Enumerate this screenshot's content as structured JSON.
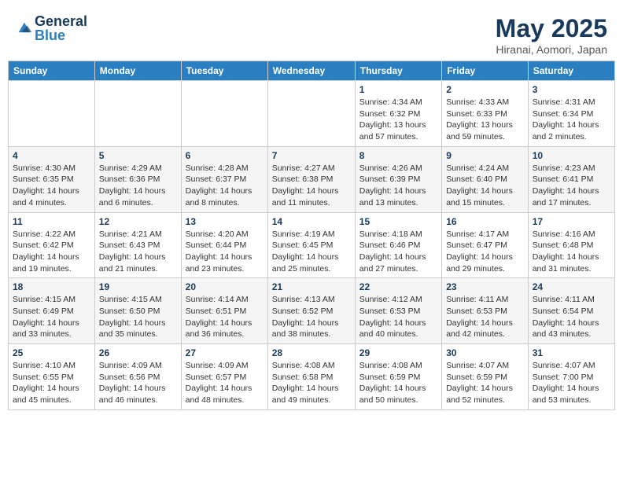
{
  "logo": {
    "general": "General",
    "blue": "Blue"
  },
  "title": {
    "month_year": "May 2025",
    "location": "Hiranai, Aomori, Japan"
  },
  "days_of_week": [
    "Sunday",
    "Monday",
    "Tuesday",
    "Wednesday",
    "Thursday",
    "Friday",
    "Saturday"
  ],
  "weeks": [
    [
      {
        "day": "",
        "info": ""
      },
      {
        "day": "",
        "info": ""
      },
      {
        "day": "",
        "info": ""
      },
      {
        "day": "",
        "info": ""
      },
      {
        "day": "1",
        "info": "Sunrise: 4:34 AM\nSunset: 6:32 PM\nDaylight: 13 hours and 57 minutes."
      },
      {
        "day": "2",
        "info": "Sunrise: 4:33 AM\nSunset: 6:33 PM\nDaylight: 13 hours and 59 minutes."
      },
      {
        "day": "3",
        "info": "Sunrise: 4:31 AM\nSunset: 6:34 PM\nDaylight: 14 hours and 2 minutes."
      }
    ],
    [
      {
        "day": "4",
        "info": "Sunrise: 4:30 AM\nSunset: 6:35 PM\nDaylight: 14 hours and 4 minutes."
      },
      {
        "day": "5",
        "info": "Sunrise: 4:29 AM\nSunset: 6:36 PM\nDaylight: 14 hours and 6 minutes."
      },
      {
        "day": "6",
        "info": "Sunrise: 4:28 AM\nSunset: 6:37 PM\nDaylight: 14 hours and 8 minutes."
      },
      {
        "day": "7",
        "info": "Sunrise: 4:27 AM\nSunset: 6:38 PM\nDaylight: 14 hours and 11 minutes."
      },
      {
        "day": "8",
        "info": "Sunrise: 4:26 AM\nSunset: 6:39 PM\nDaylight: 14 hours and 13 minutes."
      },
      {
        "day": "9",
        "info": "Sunrise: 4:24 AM\nSunset: 6:40 PM\nDaylight: 14 hours and 15 minutes."
      },
      {
        "day": "10",
        "info": "Sunrise: 4:23 AM\nSunset: 6:41 PM\nDaylight: 14 hours and 17 minutes."
      }
    ],
    [
      {
        "day": "11",
        "info": "Sunrise: 4:22 AM\nSunset: 6:42 PM\nDaylight: 14 hours and 19 minutes."
      },
      {
        "day": "12",
        "info": "Sunrise: 4:21 AM\nSunset: 6:43 PM\nDaylight: 14 hours and 21 minutes."
      },
      {
        "day": "13",
        "info": "Sunrise: 4:20 AM\nSunset: 6:44 PM\nDaylight: 14 hours and 23 minutes."
      },
      {
        "day": "14",
        "info": "Sunrise: 4:19 AM\nSunset: 6:45 PM\nDaylight: 14 hours and 25 minutes."
      },
      {
        "day": "15",
        "info": "Sunrise: 4:18 AM\nSunset: 6:46 PM\nDaylight: 14 hours and 27 minutes."
      },
      {
        "day": "16",
        "info": "Sunrise: 4:17 AM\nSunset: 6:47 PM\nDaylight: 14 hours and 29 minutes."
      },
      {
        "day": "17",
        "info": "Sunrise: 4:16 AM\nSunset: 6:48 PM\nDaylight: 14 hours and 31 minutes."
      }
    ],
    [
      {
        "day": "18",
        "info": "Sunrise: 4:15 AM\nSunset: 6:49 PM\nDaylight: 14 hours and 33 minutes."
      },
      {
        "day": "19",
        "info": "Sunrise: 4:15 AM\nSunset: 6:50 PM\nDaylight: 14 hours and 35 minutes."
      },
      {
        "day": "20",
        "info": "Sunrise: 4:14 AM\nSunset: 6:51 PM\nDaylight: 14 hours and 36 minutes."
      },
      {
        "day": "21",
        "info": "Sunrise: 4:13 AM\nSunset: 6:52 PM\nDaylight: 14 hours and 38 minutes."
      },
      {
        "day": "22",
        "info": "Sunrise: 4:12 AM\nSunset: 6:53 PM\nDaylight: 14 hours and 40 minutes."
      },
      {
        "day": "23",
        "info": "Sunrise: 4:11 AM\nSunset: 6:53 PM\nDaylight: 14 hours and 42 minutes."
      },
      {
        "day": "24",
        "info": "Sunrise: 4:11 AM\nSunset: 6:54 PM\nDaylight: 14 hours and 43 minutes."
      }
    ],
    [
      {
        "day": "25",
        "info": "Sunrise: 4:10 AM\nSunset: 6:55 PM\nDaylight: 14 hours and 45 minutes."
      },
      {
        "day": "26",
        "info": "Sunrise: 4:09 AM\nSunset: 6:56 PM\nDaylight: 14 hours and 46 minutes."
      },
      {
        "day": "27",
        "info": "Sunrise: 4:09 AM\nSunset: 6:57 PM\nDaylight: 14 hours and 48 minutes."
      },
      {
        "day": "28",
        "info": "Sunrise: 4:08 AM\nSunset: 6:58 PM\nDaylight: 14 hours and 49 minutes."
      },
      {
        "day": "29",
        "info": "Sunrise: 4:08 AM\nSunset: 6:59 PM\nDaylight: 14 hours and 50 minutes."
      },
      {
        "day": "30",
        "info": "Sunrise: 4:07 AM\nSunset: 6:59 PM\nDaylight: 14 hours and 52 minutes."
      },
      {
        "day": "31",
        "info": "Sunrise: 4:07 AM\nSunset: 7:00 PM\nDaylight: 14 hours and 53 minutes."
      }
    ]
  ]
}
